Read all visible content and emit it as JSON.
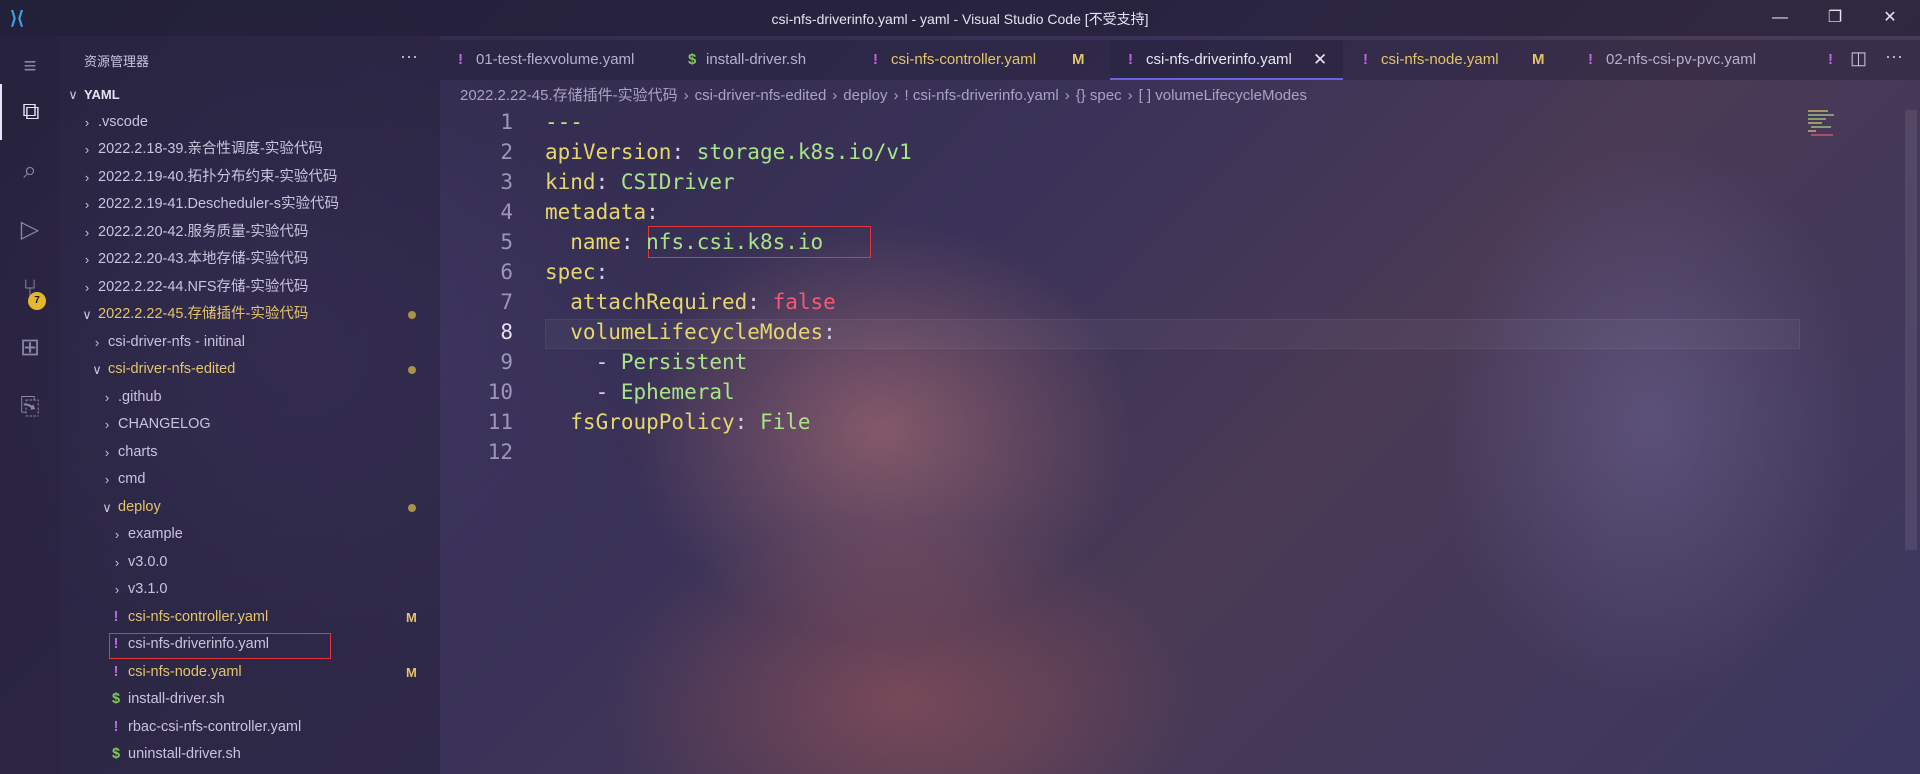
{
  "window": {
    "title": "csi-nfs-driverinfo.yaml - yaml - Visual Studio Code [不受支持]",
    "minimize": "—",
    "restore": "❐",
    "close": "✕"
  },
  "activity_bar": {
    "items": [
      {
        "name": "explorer-icon",
        "glyph": "⧉"
      },
      {
        "name": "search-icon",
        "glyph": "⌕"
      },
      {
        "name": "run-debug-icon",
        "glyph": "▷"
      },
      {
        "name": "source-control-icon",
        "glyph": "⑂"
      },
      {
        "name": "extensions-icon",
        "glyph": "⊞"
      },
      {
        "name": "remote-explorer-icon",
        "glyph": "⎘"
      }
    ],
    "scm_badge": "7"
  },
  "sidebar": {
    "title": "资源管理器",
    "more": "···",
    "tree": [
      {
        "label": "YAML",
        "chev": "∨",
        "depth": 0,
        "color": "#e6e2f0",
        "bold": true
      },
      {
        "label": ".vscode",
        "chev": "›",
        "depth": 1,
        "color": "#c9c3dc"
      },
      {
        "label": "2022.2.18-39.亲合性调度-实验代码",
        "chev": "›",
        "depth": 1,
        "color": "#c9c3dc"
      },
      {
        "label": "2022.2.19-40.拓扑分布约束-实验代码",
        "chev": "›",
        "depth": 1,
        "color": "#c9c3dc"
      },
      {
        "label": "2022.2.19-41.Descheduler-s实验代码",
        "chev": "›",
        "depth": 1,
        "color": "#c9c3dc"
      },
      {
        "label": "2022.2.20-42.服务质量-实验代码",
        "chev": "›",
        "depth": 1,
        "color": "#c9c3dc"
      },
      {
        "label": "2022.2.20-43.本地存储-实验代码",
        "chev": "›",
        "depth": 1,
        "color": "#c9c3dc"
      },
      {
        "label": "2022.2.22-44.NFS存储-实验代码",
        "chev": "›",
        "depth": 1,
        "color": "#c9c3dc"
      },
      {
        "label": "2022.2.22-45.存储插件-实验代码",
        "chev": "∨",
        "depth": 1,
        "color": "#e4c46a",
        "dot": true
      },
      {
        "label": "csi-driver-nfs - initinal",
        "chev": "›",
        "depth": 2,
        "color": "#c9c3dc"
      },
      {
        "label": "csi-driver-nfs-edited",
        "chev": "∨",
        "depth": 2,
        "color": "#e4c46a",
        "dot": true
      },
      {
        "label": ".github",
        "chev": "›",
        "depth": 3,
        "color": "#c9c3dc"
      },
      {
        "label": "CHANGELOG",
        "chev": "›",
        "depth": 3,
        "color": "#c9c3dc"
      },
      {
        "label": "charts",
        "chev": "›",
        "depth": 3,
        "color": "#c9c3dc"
      },
      {
        "label": "cmd",
        "chev": "›",
        "depth": 3,
        "color": "#c9c3dc"
      },
      {
        "label": "deploy",
        "chev": "∨",
        "depth": 3,
        "color": "#e4c46a",
        "dot": true
      },
      {
        "label": "example",
        "chev": "›",
        "depth": 4,
        "color": "#c9c3dc"
      },
      {
        "label": "v3.0.0",
        "chev": "›",
        "depth": 4,
        "color": "#c9c3dc"
      },
      {
        "label": "v3.1.0",
        "chev": "›",
        "depth": 4,
        "color": "#c9c3dc"
      },
      {
        "label": "csi-nfs-controller.yaml",
        "icon": "!",
        "icon_color": "#c068e0",
        "depth": 4,
        "color": "#e4c46a",
        "mark": "M"
      },
      {
        "label": "csi-nfs-driverinfo.yaml",
        "icon": "!",
        "icon_color": "#c068e0",
        "depth": 4,
        "color": "#c9c3dc"
      },
      {
        "label": "csi-nfs-node.yaml",
        "icon": "!",
        "icon_color": "#c068e0",
        "depth": 4,
        "color": "#e4c46a",
        "mark": "M"
      },
      {
        "label": "install-driver.sh",
        "icon": "$",
        "icon_color": "#7ec85a",
        "depth": 4,
        "color": "#c9c3dc"
      },
      {
        "label": "rbac-csi-nfs-controller.yaml",
        "icon": "!",
        "icon_color": "#c068e0",
        "depth": 4,
        "color": "#c9c3dc"
      },
      {
        "label": "uninstall-driver.sh",
        "icon": "$",
        "icon_color": "#7ec85a",
        "depth": 4,
        "color": "#c9c3dc"
      }
    ]
  },
  "tabs": [
    {
      "label": "01-test-flexvolume.yaml",
      "icon": "!",
      "icon_color": "#c068e0",
      "color": "#b7b0cc"
    },
    {
      "label": "install-driver.sh",
      "icon": "$",
      "icon_color": "#7ec85a",
      "color": "#b7b0cc"
    },
    {
      "label": "csi-nfs-controller.yaml",
      "icon": "!",
      "icon_color": "#c068e0",
      "color": "#e4c46a",
      "mark": "M"
    },
    {
      "label": "csi-nfs-driverinfo.yaml",
      "icon": "!",
      "icon_color": "#c068e0",
      "color": "#e8e4f4",
      "active": true,
      "close": "✕"
    },
    {
      "label": "csi-nfs-node.yaml",
      "icon": "!",
      "icon_color": "#c068e0",
      "color": "#e4c46a",
      "mark": "M"
    },
    {
      "label": "02-nfs-csi-pv-pvc.yaml",
      "icon": "!",
      "icon_color": "#c068e0",
      "color": "#b7b0cc"
    },
    {
      "label": "",
      "icon": "!",
      "icon_color": "#c068e0",
      "color": "#b7b0cc"
    }
  ],
  "tab_actions": {
    "split": "◫",
    "more": "···"
  },
  "breadcrumb": [
    "2022.2.22-45.存储插件-实验代码",
    "›",
    "csi-driver-nfs-edited",
    "›",
    "deploy",
    "›",
    "! csi-nfs-driverinfo.yaml",
    "›",
    "{} spec",
    "›",
    "[ ] volumeLifecycleModes"
  ],
  "editor": {
    "current_line": 8,
    "lines": [
      [
        {
          "t": "---",
          "c": "k"
        }
      ],
      [
        {
          "t": "apiVersion",
          "c": "k"
        },
        {
          "t": ": ",
          "c": "p"
        },
        {
          "t": "storage.k8s.io/v1",
          "c": "v"
        }
      ],
      [
        {
          "t": "kind",
          "c": "k"
        },
        {
          "t": ": ",
          "c": "p"
        },
        {
          "t": "CSIDriver",
          "c": "v"
        }
      ],
      [
        {
          "t": "metadata",
          "c": "k"
        },
        {
          "t": ":",
          "c": "p"
        }
      ],
      [
        {
          "t": "  name",
          "c": "k"
        },
        {
          "t": ": ",
          "c": "p"
        },
        {
          "t": "nfs.csi.k8s.io",
          "c": "v"
        }
      ],
      [
        {
          "t": "spec",
          "c": "k"
        },
        {
          "t": ":",
          "c": "p"
        }
      ],
      [
        {
          "t": "  attachRequired",
          "c": "k"
        },
        {
          "t": ": ",
          "c": "p"
        },
        {
          "t": "false",
          "c": "f"
        }
      ],
      [
        {
          "t": "  volumeLifecycleModes",
          "c": "k"
        },
        {
          "t": ":",
          "c": "p"
        }
      ],
      [
        {
          "t": "    - ",
          "c": "p"
        },
        {
          "t": "Persistent",
          "c": "v"
        }
      ],
      [
        {
          "t": "    - ",
          "c": "p"
        },
        {
          "t": "Ephemeral",
          "c": "v"
        }
      ],
      [
        {
          "t": "  fsGroupPolicy",
          "c": "k"
        },
        {
          "t": ": ",
          "c": "p"
        },
        {
          "t": "File",
          "c": "v"
        }
      ],
      []
    ]
  }
}
